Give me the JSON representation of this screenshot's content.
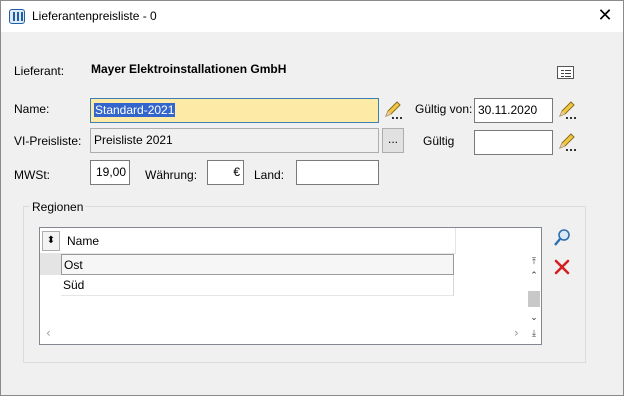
{
  "window": {
    "title": "Lieferantenpreisliste - 0",
    "close_label": "✕"
  },
  "supplier": {
    "label": "Lieferant:",
    "value": "Mayer Elektroinstallationen GmbH"
  },
  "form": {
    "name_label": "Name:",
    "name_value": "Standard-2021",
    "pricelist_label": "VI-Preisliste:",
    "pricelist_value": "Preisliste 2021",
    "pricelist_button": "...",
    "vat_label": "MWSt:",
    "vat_value": "19,00",
    "currency_label": "Währung:",
    "currency_value": "€",
    "country_label": "Land:",
    "country_value": "",
    "valid_from_label": "Gültig von:",
    "valid_from_value": "30.11.2020",
    "valid_to_label": "Gültig",
    "valid_to_value": ""
  },
  "regions": {
    "title": "Regionen",
    "column_header": "Name",
    "rows": [
      "Ost",
      "Süd"
    ]
  },
  "icons": {
    "app": "app-icon",
    "card": "card-view-icon",
    "edit": "pencil-edit-icon",
    "search": "search-icon",
    "delete": "delete-icon"
  },
  "colors": {
    "focus_field": "#fdeaa7",
    "selection": "#3366cc",
    "delete": "#d42020"
  }
}
